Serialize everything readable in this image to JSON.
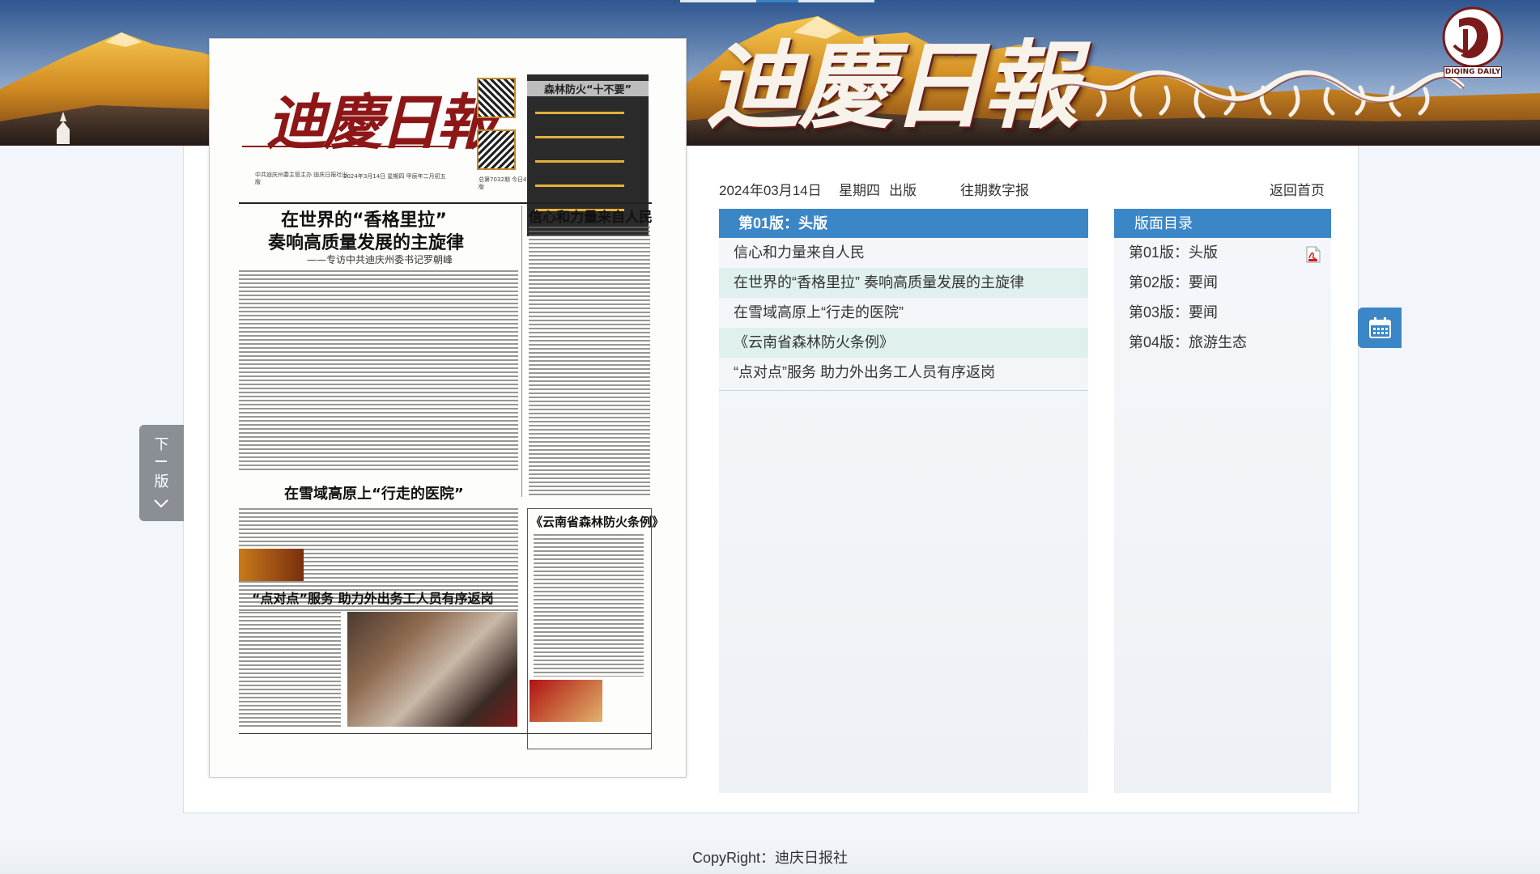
{
  "banner": {
    "title": "迪慶日報",
    "tibetan_alt": "Tibetan script newspaper name",
    "logo_text": "DIQING DAILY"
  },
  "newspaper_page": {
    "masthead": "迪慶日報",
    "fire_box_title": "森林防火“十不要”",
    "meta_left": "中共迪庆州委主管主办 迪庆日报社出版",
    "meta_date": "2024年3月14日 星期四 甲辰年二月初五",
    "meta_issue": "总第7032期 今日4版",
    "headline_main_1": "在世界的“香格里拉”",
    "headline_main_2": "奏响高质量发展的主旋律",
    "subheadline": "——专访中共迪庆州委书记罗朝峰",
    "headline_right": "信心和力量来自人民",
    "headline_mid": "在雪域高原上“行走的医院”",
    "headline_box": "《云南省森林防火条例》",
    "headline_bottom": "“点对点”服务 助力外出务工人员有序返岗"
  },
  "side_tab": {
    "chars": [
      "下",
      "版"
    ],
    "icon": "chevron-down-icon"
  },
  "info_bar": {
    "date": "2024年03月14日",
    "weekday": "星期四",
    "publish": "出版",
    "archive_link": "往期数字报",
    "home_link": "返回首页"
  },
  "current_page": {
    "heading": "第01版：头版",
    "articles": [
      {
        "title": "信心和力量来自人民"
      },
      {
        "title": "在世界的“香格里拉” 奏响高质量发展的主旋律"
      },
      {
        "title": "在雪域高原上“行走的医院”"
      },
      {
        "title": "《云南省森林防火条例》"
      },
      {
        "title": "“点对点”服务 助力外出务工人员有序返岗"
      }
    ]
  },
  "page_directory": {
    "heading": "版面目录",
    "pages": [
      {
        "label": "第01版：头版",
        "icon": "pdf-icon"
      },
      {
        "label": "第02版：要闻"
      },
      {
        "label": "第03版：要闻"
      },
      {
        "label": "第04版：旅游生态"
      }
    ]
  },
  "calendar_button": {
    "icon": "calendar-icon"
  },
  "footer": {
    "copyright": "CopyRight：迪庆日报社"
  },
  "colors": {
    "accent": "#3b86c6",
    "row_alt": "#dff0ef",
    "masthead_red": "#8d1717"
  }
}
